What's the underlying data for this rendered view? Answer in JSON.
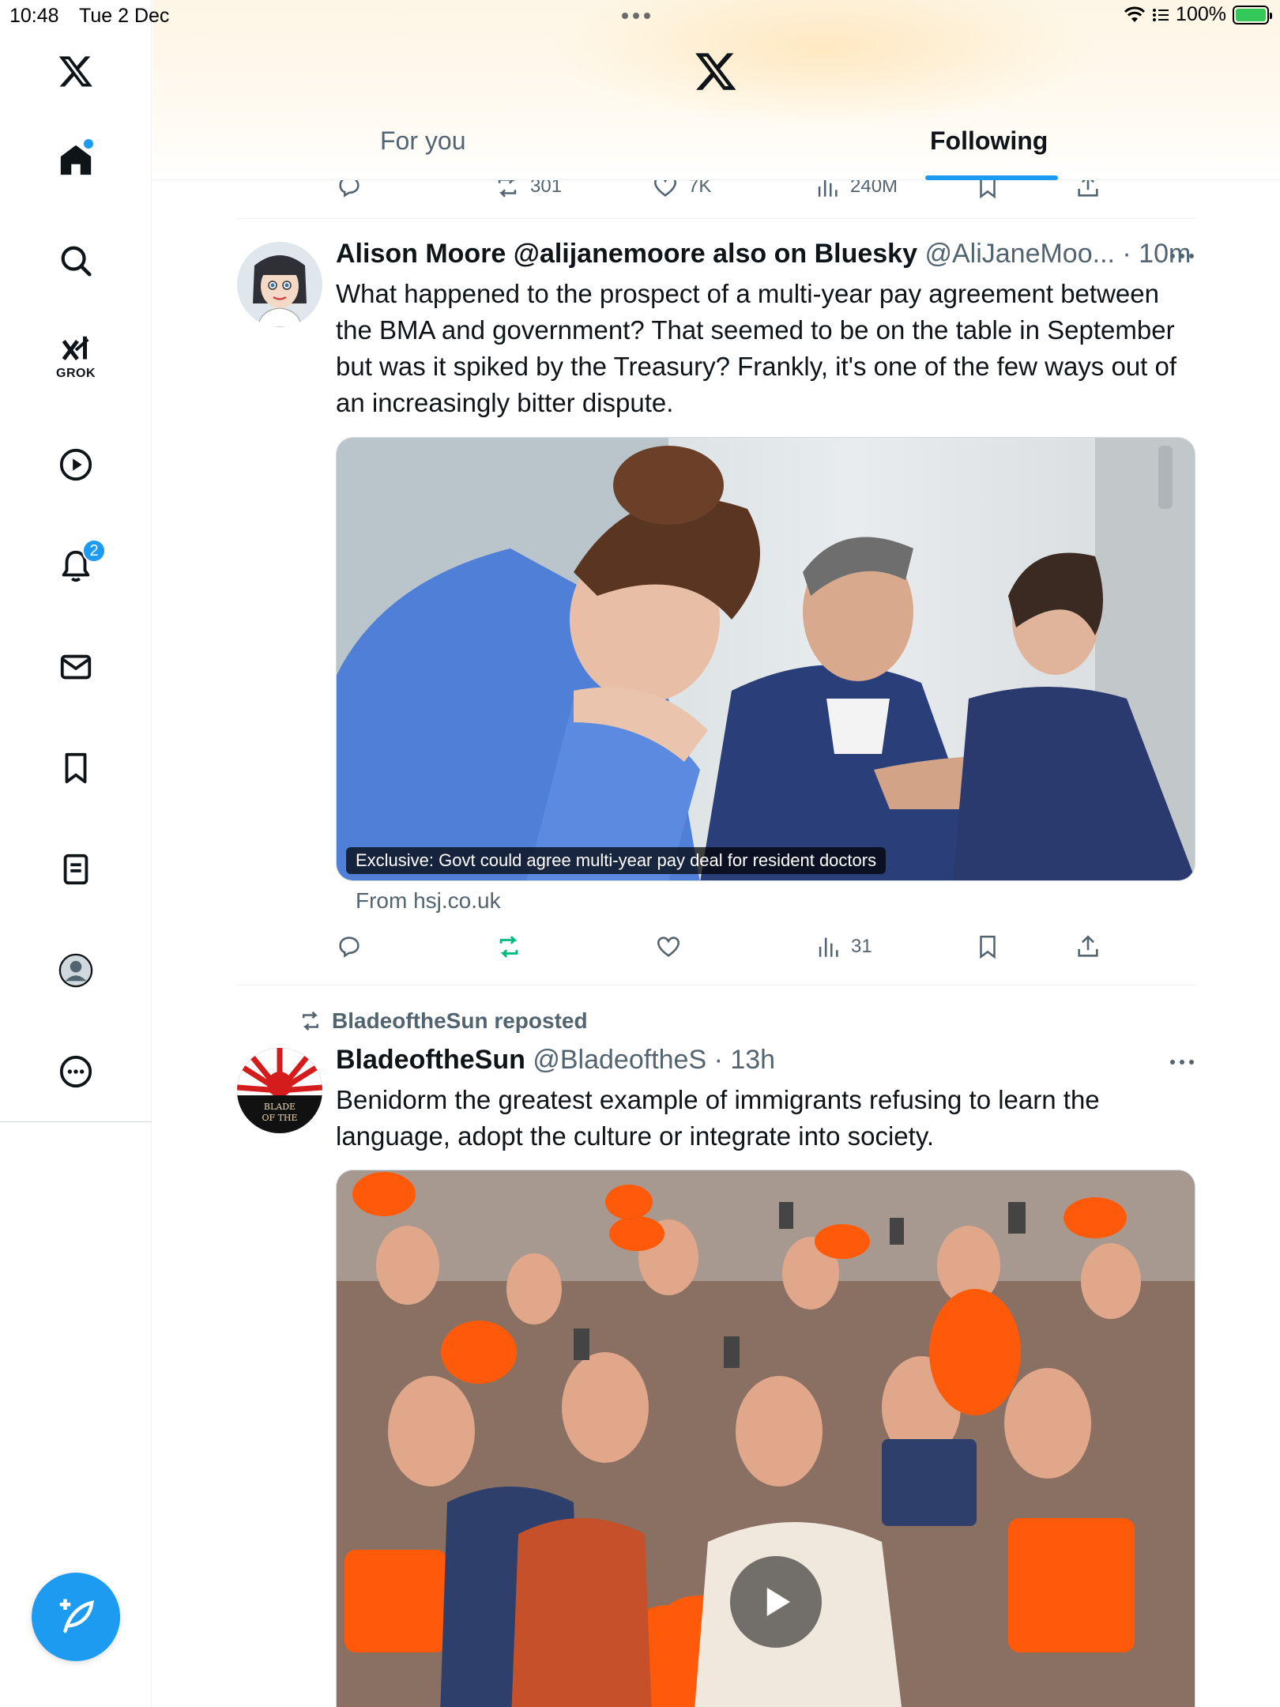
{
  "status_bar": {
    "time": "10:48",
    "date": "Tue 2 Dec",
    "battery": "100%"
  },
  "sidebar": {
    "grok_label": "GROK",
    "notifications_badge": "2",
    "items": [
      "home-icon",
      "search-icon",
      "grok-icon",
      "video-icon",
      "bell-icon",
      "mail-icon",
      "bookmark-icon",
      "list-icon",
      "profile-icon",
      "more-icon"
    ]
  },
  "header": {
    "tabs": [
      {
        "label": "For you",
        "active": false
      },
      {
        "label": "Following",
        "active": true
      }
    ]
  },
  "prev_tweet": {
    "reposts": "301",
    "likes": "7K",
    "views": "240M"
  },
  "tweets": [
    {
      "name": "Alison Moore @alijanemoore also on Bluesky",
      "handle": "@AliJaneMoo... · 10m",
      "text": "What happened to the prospect of a multi-year pay agreement between the BMA and government? That seemed to be on the table in September but was it spiked by the Treasury? Frankly, it's one of the few ways out of an increasingly bitter dispute.",
      "card_caption": "Exclusive: Govt could agree multi-year pay deal for resident doctors",
      "card_source": "From hsj.co.uk",
      "views": "31"
    },
    {
      "reposted_by": "BladeoftheSun reposted",
      "name": "BladeoftheSun",
      "handle": "@BladeoftheS · 13h",
      "text": "Benidorm the greatest example of immigrants refusing to learn the language, adopt the culture or integrate into society.",
      "avatar_text": "BLADE OF THE"
    }
  ],
  "colors": {
    "accent": "#1d9bf0",
    "repost_green": "#00ba7c",
    "muted": "#536471"
  }
}
